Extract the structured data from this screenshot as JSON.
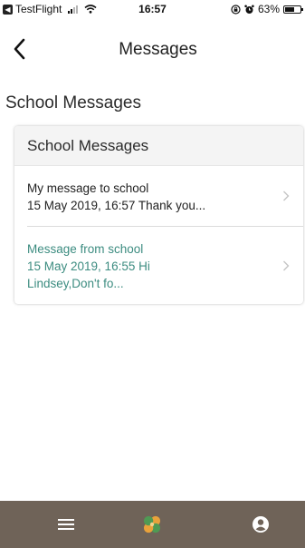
{
  "status_bar": {
    "carrier": "TestFlight",
    "time": "16:57",
    "battery_percent": "63%",
    "battery_level": 0.63
  },
  "nav": {
    "title": "Messages",
    "back_icon": "chevron-left-icon"
  },
  "section": {
    "title": "School Messages"
  },
  "card": {
    "header": "School Messages",
    "messages": [
      {
        "title": "My message to school",
        "preview": "15 May 2019, 16:57 Thank you..."
      },
      {
        "title": "Message from school",
        "preview": "15 May 2019, 16:55 Hi Lindsey,Don't fo..."
      }
    ]
  },
  "tab_bar": {
    "icons": [
      "menu-icon",
      "clover-logo-icon",
      "user-account-icon"
    ]
  },
  "colors": {
    "accent": "#3c8c80",
    "tab_bar": "#6f6358",
    "clover_orange": "#e9a23b",
    "clover_green": "#4f9a54"
  }
}
